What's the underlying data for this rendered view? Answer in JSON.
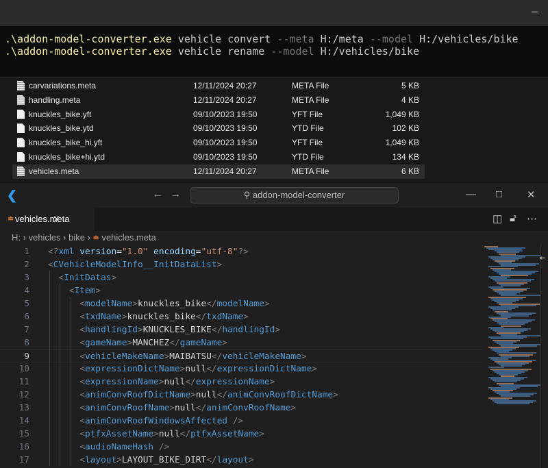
{
  "terminal": {
    "lines": [
      {
        "exe": ".\\addon-model-converter.exe",
        "parts": [
          [
            "p",
            " vehicle convert "
          ],
          [
            "f",
            "--meta"
          ],
          [
            "p",
            " H:/meta "
          ],
          [
            "f",
            "--model"
          ],
          [
            "p",
            " H:/vehicles/bike"
          ]
        ]
      },
      {
        "exe": ".\\addon-model-converter.exe",
        "parts": [
          [
            "p",
            " vehicle rename "
          ],
          [
            "f",
            "--model"
          ],
          [
            "p",
            " H:/vehicles/bike"
          ]
        ]
      }
    ]
  },
  "explorer": {
    "files": [
      {
        "name": "carvariations.meta",
        "date": "12/11/2024 20:27",
        "type": "META File",
        "size": "5 KB",
        "icon": "meta-file-icon"
      },
      {
        "name": "handling.meta",
        "date": "12/11/2024 20:27",
        "type": "META File",
        "size": "4 KB",
        "icon": "meta-file-icon"
      },
      {
        "name": "knuckles_bike.yft",
        "date": "09/10/2023 19:50",
        "type": "YFT File",
        "size": "1,049 KB",
        "icon": "blank-file-icon"
      },
      {
        "name": "knuckles_bike.ytd",
        "date": "09/10/2023 19:50",
        "type": "YTD File",
        "size": "102 KB",
        "icon": "blank-file-icon"
      },
      {
        "name": "knuckles_bike_hi.yft",
        "date": "09/10/2023 19:50",
        "type": "YFT File",
        "size": "1,049 KB",
        "icon": "blank-file-icon"
      },
      {
        "name": "knuckles_bike+hi.ytd",
        "date": "09/10/2023 19:50",
        "type": "YTD File",
        "size": "134 KB",
        "icon": "blank-file-icon"
      },
      {
        "name": "vehicles.meta",
        "date": "12/11/2024 20:27",
        "type": "META File",
        "size": "6 KB",
        "icon": "meta-file-icon",
        "selected": true
      }
    ]
  },
  "vscode": {
    "search": "addon-model-converter",
    "tab": {
      "label": "vehicles.meta",
      "close": "X"
    },
    "breadcrumb": [
      "H:",
      "vehicles",
      "bike",
      "vehicles.meta"
    ],
    "current_line": 9,
    "code": [
      [
        [
          "p",
          "<?"
        ],
        [
          "t",
          "xml"
        ],
        [
          "a",
          " version"
        ],
        [
          "x",
          "="
        ],
        [
          "s",
          "\"1.0\""
        ],
        [
          "a",
          " encoding"
        ],
        [
          "x",
          "="
        ],
        [
          "s",
          "\"utf-8\""
        ],
        [
          "p",
          "?>"
        ]
      ],
      [
        [
          "p",
          "<"
        ],
        [
          "t",
          "CVehicleModelInfo__InitDataList"
        ],
        [
          "p",
          ">"
        ]
      ],
      [
        [
          "x",
          "  "
        ],
        [
          "p",
          "<"
        ],
        [
          "t",
          "InitDatas"
        ],
        [
          "p",
          ">"
        ]
      ],
      [
        [
          "x",
          "    "
        ],
        [
          "p",
          "<"
        ],
        [
          "t",
          "Item"
        ],
        [
          "p",
          ">"
        ]
      ],
      [
        [
          "x",
          "      "
        ],
        [
          "p",
          "<"
        ],
        [
          "t",
          "modelName"
        ],
        [
          "p",
          ">"
        ],
        [
          "x",
          "knuckles_bike"
        ],
        [
          "p",
          "</"
        ],
        [
          "t",
          "modelName"
        ],
        [
          "p",
          ">"
        ]
      ],
      [
        [
          "x",
          "      "
        ],
        [
          "p",
          "<"
        ],
        [
          "t",
          "txdName"
        ],
        [
          "p",
          ">"
        ],
        [
          "x",
          "knuckles_bike"
        ],
        [
          "p",
          "</"
        ],
        [
          "t",
          "txdName"
        ],
        [
          "p",
          ">"
        ]
      ],
      [
        [
          "x",
          "      "
        ],
        [
          "p",
          "<"
        ],
        [
          "t",
          "handlingId"
        ],
        [
          "p",
          ">"
        ],
        [
          "x",
          "KNUCKLES_BIKE"
        ],
        [
          "p",
          "</"
        ],
        [
          "t",
          "handlingId"
        ],
        [
          "p",
          ">"
        ]
      ],
      [
        [
          "x",
          "      "
        ],
        [
          "p",
          "<"
        ],
        [
          "t",
          "gameName"
        ],
        [
          "p",
          ">"
        ],
        [
          "x",
          "MANCHEZ"
        ],
        [
          "p",
          "</"
        ],
        [
          "t",
          "gameName"
        ],
        [
          "p",
          ">"
        ]
      ],
      [
        [
          "x",
          "      "
        ],
        [
          "p",
          "<"
        ],
        [
          "t",
          "vehicleMakeName"
        ],
        [
          "p",
          ">"
        ],
        [
          "x",
          "MAIBATSU"
        ],
        [
          "p",
          "</"
        ],
        [
          "t",
          "vehicleMakeName"
        ],
        [
          "p",
          ">"
        ]
      ],
      [
        [
          "x",
          "      "
        ],
        [
          "p",
          "<"
        ],
        [
          "t",
          "expressionDictName"
        ],
        [
          "p",
          ">"
        ],
        [
          "x",
          "null"
        ],
        [
          "p",
          "</"
        ],
        [
          "t",
          "expressionDictName"
        ],
        [
          "p",
          ">"
        ]
      ],
      [
        [
          "x",
          "      "
        ],
        [
          "p",
          "<"
        ],
        [
          "t",
          "expressionName"
        ],
        [
          "p",
          ">"
        ],
        [
          "x",
          "null"
        ],
        [
          "p",
          "</"
        ],
        [
          "t",
          "expressionName"
        ],
        [
          "p",
          ">"
        ]
      ],
      [
        [
          "x",
          "      "
        ],
        [
          "p",
          "<"
        ],
        [
          "t",
          "animConvRoofDictName"
        ],
        [
          "p",
          ">"
        ],
        [
          "x",
          "null"
        ],
        [
          "p",
          "</"
        ],
        [
          "t",
          "animConvRoofDictName"
        ],
        [
          "p",
          ">"
        ]
      ],
      [
        [
          "x",
          "      "
        ],
        [
          "p",
          "<"
        ],
        [
          "t",
          "animConvRoofName"
        ],
        [
          "p",
          ">"
        ],
        [
          "x",
          "null"
        ],
        [
          "p",
          "</"
        ],
        [
          "t",
          "animConvRoofName"
        ],
        [
          "p",
          ">"
        ]
      ],
      [
        [
          "x",
          "      "
        ],
        [
          "p",
          "<"
        ],
        [
          "t",
          "animConvRoofWindowsAffected"
        ],
        [
          "p",
          " />"
        ]
      ],
      [
        [
          "x",
          "      "
        ],
        [
          "p",
          "<"
        ],
        [
          "t",
          "ptfxAssetName"
        ],
        [
          "p",
          ">"
        ],
        [
          "x",
          "null"
        ],
        [
          "p",
          "</"
        ],
        [
          "t",
          "ptfxAssetName"
        ],
        [
          "p",
          ">"
        ]
      ],
      [
        [
          "x",
          "      "
        ],
        [
          "p",
          "<"
        ],
        [
          "t",
          "audioNameHash"
        ],
        [
          "p",
          " />"
        ]
      ],
      [
        [
          "x",
          "      "
        ],
        [
          "p",
          "<"
        ],
        [
          "t",
          "layout"
        ],
        [
          "p",
          ">"
        ],
        [
          "x",
          "LAYOUT_BIKE_DIRT"
        ],
        [
          "p",
          "</"
        ],
        [
          "t",
          "layout"
        ],
        [
          "p",
          ">"
        ]
      ]
    ]
  }
}
